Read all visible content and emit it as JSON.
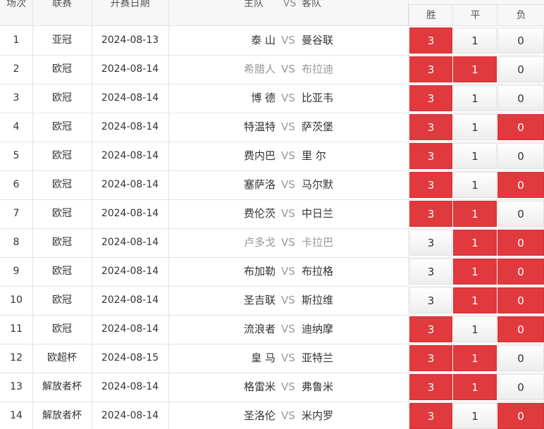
{
  "header": {
    "col_index": "场次",
    "col_league": "联赛",
    "col_date": "开赛日期",
    "col_home": "主队",
    "col_vs": "VS",
    "col_away": "客队",
    "col_win": "胜",
    "col_draw": "平",
    "col_lose": "负"
  },
  "rows": [
    {
      "index": "1",
      "league": "亚冠",
      "date": "2024-08-13",
      "home": "泰 山",
      "vs": "VS",
      "away": "曼谷联",
      "win": "3",
      "draw": "1",
      "lose": "0",
      "selected": [
        "win"
      ],
      "muted": false
    },
    {
      "index": "2",
      "league": "欧冠",
      "date": "2024-08-14",
      "home": "希腊人",
      "vs": "VS",
      "away": "布拉迪",
      "win": "3",
      "draw": "1",
      "lose": "0",
      "selected": [
        "win",
        "draw"
      ],
      "muted": true
    },
    {
      "index": "3",
      "league": "欧冠",
      "date": "2024-08-14",
      "home": "博 德",
      "vs": "VS",
      "away": "比亚韦",
      "win": "3",
      "draw": "1",
      "lose": "0",
      "selected": [
        "win"
      ],
      "muted": false
    },
    {
      "index": "4",
      "league": "欧冠",
      "date": "2024-08-14",
      "home": "特温特",
      "vs": "VS",
      "away": "萨茨堡",
      "win": "3",
      "draw": "1",
      "lose": "0",
      "selected": [
        "win",
        "lose"
      ],
      "muted": false
    },
    {
      "index": "5",
      "league": "欧冠",
      "date": "2024-08-14",
      "home": "费内巴",
      "vs": "VS",
      "away": "里 尔",
      "win": "3",
      "draw": "1",
      "lose": "0",
      "selected": [
        "win"
      ],
      "muted": false
    },
    {
      "index": "6",
      "league": "欧冠",
      "date": "2024-08-14",
      "home": "塞萨洛",
      "vs": "VS",
      "away": "马尔默",
      "win": "3",
      "draw": "1",
      "lose": "0",
      "selected": [
        "win",
        "lose"
      ],
      "muted": false
    },
    {
      "index": "7",
      "league": "欧冠",
      "date": "2024-08-14",
      "home": "费伦茨",
      "vs": "VS",
      "away": "中日兰",
      "win": "3",
      "draw": "1",
      "lose": "0",
      "selected": [
        "win",
        "draw"
      ],
      "muted": false
    },
    {
      "index": "8",
      "league": "欧冠",
      "date": "2024-08-14",
      "home": "卢多戈",
      "vs": "VS",
      "away": "卡拉巴",
      "win": "3",
      "draw": "1",
      "lose": "0",
      "selected": [
        "draw",
        "lose"
      ],
      "muted": true
    },
    {
      "index": "9",
      "league": "欧冠",
      "date": "2024-08-14",
      "home": "布加勒",
      "vs": "VS",
      "away": "布拉格",
      "win": "3",
      "draw": "1",
      "lose": "0",
      "selected": [
        "draw",
        "lose"
      ],
      "muted": false
    },
    {
      "index": "10",
      "league": "欧冠",
      "date": "2024-08-14",
      "home": "圣吉联",
      "vs": "VS",
      "away": "斯拉维",
      "win": "3",
      "draw": "1",
      "lose": "0",
      "selected": [
        "draw",
        "lose"
      ],
      "muted": false
    },
    {
      "index": "11",
      "league": "欧冠",
      "date": "2024-08-14",
      "home": "流浪者",
      "vs": "VS",
      "away": "迪纳摩",
      "win": "3",
      "draw": "1",
      "lose": "0",
      "selected": [
        "win",
        "lose"
      ],
      "muted": false
    },
    {
      "index": "12",
      "league": "欧超杯",
      "date": "2024-08-15",
      "home": "皇 马",
      "vs": "VS",
      "away": "亚特兰",
      "win": "3",
      "draw": "1",
      "lose": "0",
      "selected": [
        "win",
        "draw"
      ],
      "muted": false
    },
    {
      "index": "13",
      "league": "解放者杯",
      "date": "2024-08-14",
      "home": "格雷米",
      "vs": "VS",
      "away": "弗鲁米",
      "win": "3",
      "draw": "1",
      "lose": "0",
      "selected": [
        "win",
        "draw"
      ],
      "muted": false
    },
    {
      "index": "14",
      "league": "解放者杯",
      "date": "2024-08-14",
      "home": "圣洛伦",
      "vs": "VS",
      "away": "米内罗",
      "win": "3",
      "draw": "1",
      "lose": "0",
      "selected": [
        "win",
        "lose"
      ],
      "muted": false
    }
  ],
  "colors": {
    "selected": "#e03a3e",
    "muted_text": "#999999"
  }
}
